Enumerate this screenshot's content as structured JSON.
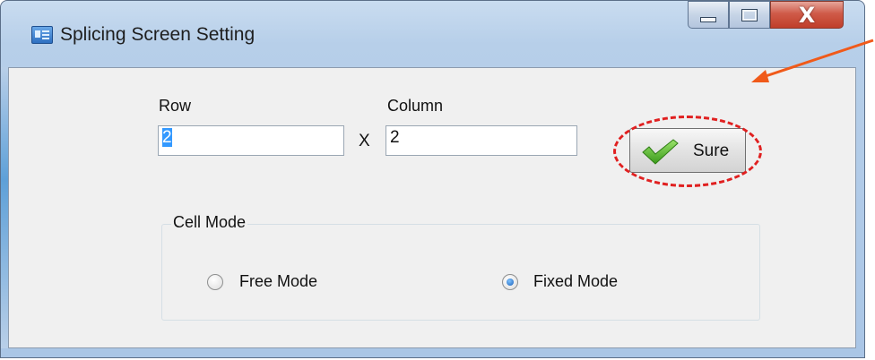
{
  "window": {
    "title": "Splicing Screen Setting",
    "icon": "app-form-icon",
    "caption_buttons": {
      "minimize": "minimize-icon",
      "maximize": "maximize-icon",
      "close": "X"
    }
  },
  "form": {
    "row_label": "Row",
    "column_label": "Column",
    "row_value": "2",
    "column_value": "2",
    "times_sign": "X",
    "sure_button": {
      "label": "Sure",
      "icon": "checkmark-icon"
    }
  },
  "cell_mode": {
    "group_label": "Cell Mode",
    "options": [
      {
        "label": "Free Mode",
        "selected": false
      },
      {
        "label": "Fixed Mode",
        "selected": true
      }
    ]
  },
  "annotation": {
    "highlight_color": "#e02020",
    "arrow_color": "#f05a1a"
  }
}
